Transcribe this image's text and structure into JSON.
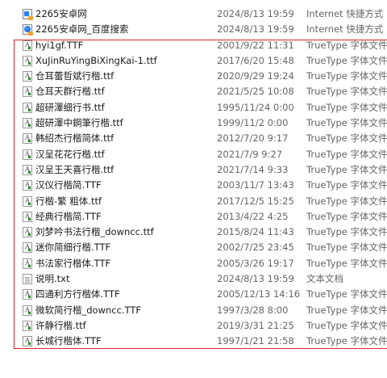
{
  "files": [
    {
      "name": "2265安卓网",
      "date": "2024/8/13 19:59",
      "type": "Internet 快捷方式",
      "icon": "url-shortcut-icon"
    },
    {
      "name": "2265安卓网_百度搜索",
      "date": "2024/8/13 19:59",
      "type": "Internet 快捷方式",
      "icon": "url-shortcut-icon"
    },
    {
      "name": "hyi1gf.TTF",
      "date": "2001/9/22 11:31",
      "type": "TrueType 字体文件",
      "icon": "font-file-icon"
    },
    {
      "name": "XuJinRuYingBiXingKai-1.ttf",
      "date": "2017/6/20 15:48",
      "type": "TrueType 字体文件",
      "icon": "font-file-icon"
    },
    {
      "name": "仓耳蕾哲斌行楷.ttf",
      "date": "2020/9/29 19:24",
      "type": "TrueType 字体文件",
      "icon": "font-file-icon"
    },
    {
      "name": "仓耳天群行楷.ttf",
      "date": "2021/5/25 10:08",
      "type": "TrueType 字体文件",
      "icon": "font-file-icon"
    },
    {
      "name": "超研澤细行书.ttf",
      "date": "1995/11/24 0:00",
      "type": "TrueType 字体文件",
      "icon": "font-file-icon"
    },
    {
      "name": "超研澤中鋼筆行楷.ttf",
      "date": "1999/11/2 0:00",
      "type": "TrueType 字体文件",
      "icon": "font-file-icon"
    },
    {
      "name": "韩绍杰行楷简体.ttf",
      "date": "2012/7/20 9:17",
      "type": "TrueType 字体文件",
      "icon": "font-file-icon"
    },
    {
      "name": "汉呈花花行楷.ttf",
      "date": "2021/7/9 9:27",
      "type": "TrueType 字体文件",
      "icon": "font-file-icon"
    },
    {
      "name": "汉呈王天喜行楷.ttf",
      "date": "2021/7/14 9:33",
      "type": "TrueType 字体文件",
      "icon": "font-file-icon"
    },
    {
      "name": "汉仪行楷简.TTF",
      "date": "2003/11/7 13:43",
      "type": "TrueType 字体文件",
      "icon": "font-file-icon"
    },
    {
      "name": "行楷-繁 粗体.ttf",
      "date": "2017/12/5 15:25",
      "type": "TrueType 字体文件",
      "icon": "font-file-icon"
    },
    {
      "name": "经典行楷简.TTF",
      "date": "2013/4/22 4:25",
      "type": "TrueType 字体文件",
      "icon": "font-file-icon"
    },
    {
      "name": "刘梦吟书法行楷_downcc.ttf",
      "date": "2015/8/24 11:43",
      "type": "TrueType 字体文件",
      "icon": "font-file-icon"
    },
    {
      "name": "迷你简细行楷.TTF",
      "date": "2002/7/25 23:45",
      "type": "TrueType 字体文件",
      "icon": "font-file-icon"
    },
    {
      "name": "书法家行楷体.TTF",
      "date": "2005/3/26 19:17",
      "type": "TrueType 字体文件",
      "icon": "font-file-icon"
    },
    {
      "name": "说明.txt",
      "date": "2024/8/13 19:59",
      "type": "文本文档",
      "icon": "text-file-icon"
    },
    {
      "name": "四通利方行楷体.TTF",
      "date": "2005/12/13 14:16",
      "type": "TrueType 字体文件",
      "icon": "font-file-icon"
    },
    {
      "name": "微软简行楷_downcc.TTF",
      "date": "1997/3/28 8:00",
      "type": "TrueType 字体文件",
      "icon": "font-file-icon"
    },
    {
      "name": "许静行楷.ttf",
      "date": "2019/3/31 21:25",
      "type": "TrueType 字体文件",
      "icon": "font-file-icon"
    },
    {
      "name": "长城行楷体.TTF",
      "date": "1997/1/21 21:58",
      "type": "TrueType 字体文件",
      "icon": "font-file-icon"
    }
  ]
}
